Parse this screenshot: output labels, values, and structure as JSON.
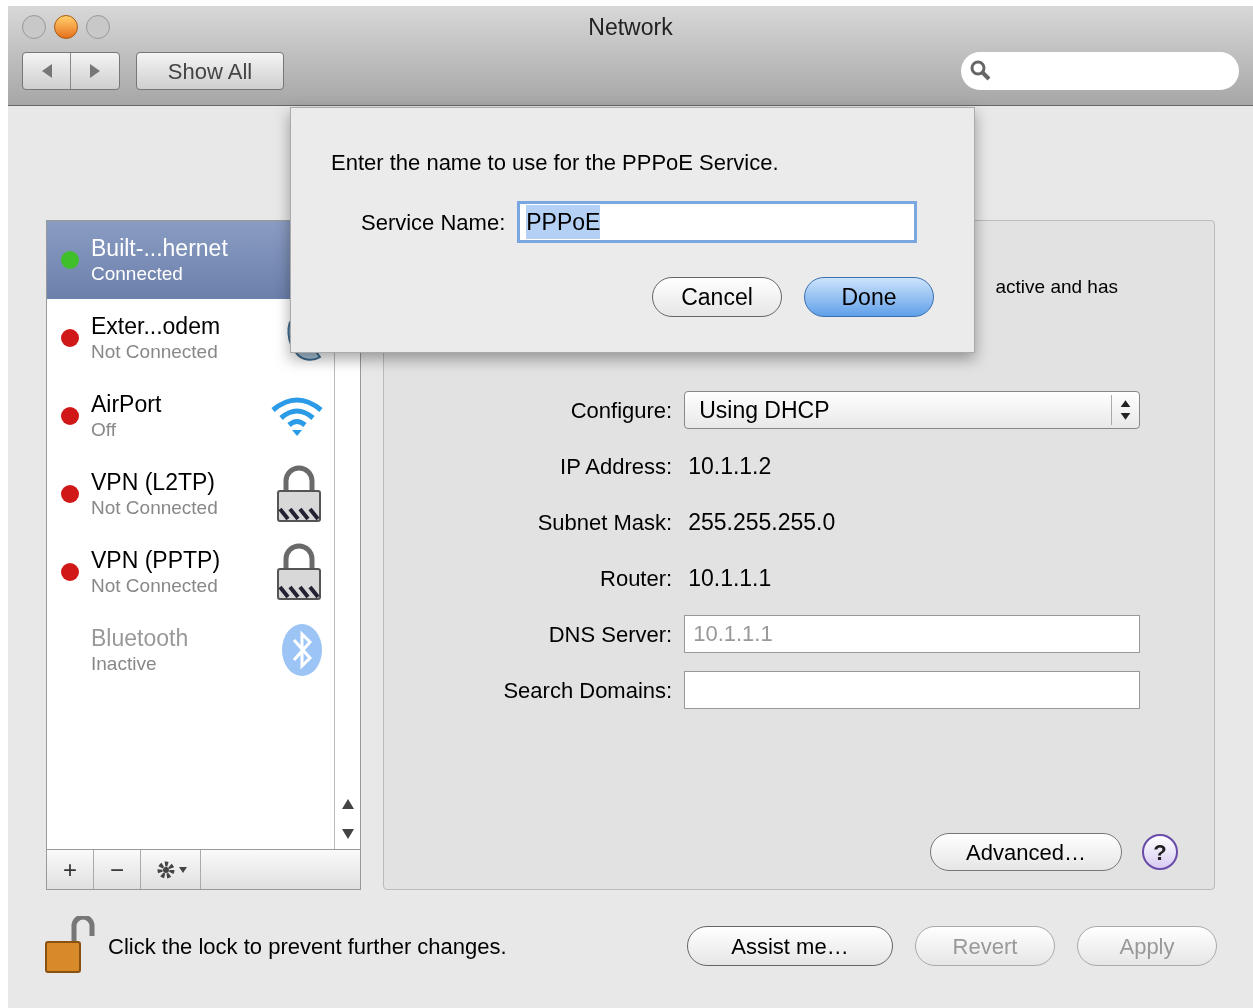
{
  "window": {
    "title": "Network",
    "show_all": "Show All"
  },
  "services": [
    {
      "name": "Built-...hernet",
      "status": "Connected",
      "color": "#3fbf2a",
      "selected": true,
      "inactive": false,
      "kind": "ethernet"
    },
    {
      "name": "Exter...odem",
      "status": "Not Connected",
      "color": "#d01818",
      "selected": false,
      "inactive": false,
      "kind": "phone"
    },
    {
      "name": "AirPort",
      "status": "Off",
      "color": "#d01818",
      "selected": false,
      "inactive": false,
      "kind": "wifi"
    },
    {
      "name": "VPN (L2TP)",
      "status": "Not Connected",
      "color": "#d01818",
      "selected": false,
      "inactive": false,
      "kind": "lock"
    },
    {
      "name": "VPN (PPTP)",
      "status": "Not Connected",
      "color": "#d01818",
      "selected": false,
      "inactive": false,
      "kind": "lock"
    },
    {
      "name": "Bluetooth",
      "status": "Inactive",
      "selected": false,
      "inactive": true,
      "kind": "bluetooth"
    }
  ],
  "sidebar_toolbar": [
    "+",
    "−"
  ],
  "detail": {
    "status_text": "active and has",
    "rows": [
      {
        "kind": "select",
        "label": "Configure:",
        "value": "Using DHCP"
      },
      {
        "kind": "text",
        "label": "IP Address:",
        "value": "10.1.1.2"
      },
      {
        "kind": "text",
        "label": "Subnet Mask:",
        "value": "255.255.255.0"
      },
      {
        "kind": "text",
        "label": "Router:",
        "value": "10.1.1.1"
      },
      {
        "kind": "field",
        "label": "DNS Server:",
        "placeholder": "10.1.1.1"
      },
      {
        "kind": "field",
        "label": "Search Domains:"
      }
    ],
    "advanced": "Advanced…",
    "help": "?"
  },
  "lock_text": "Click the lock to prevent further changes.",
  "buttons": [
    {
      "label": "Assist me…",
      "disabled": false
    },
    {
      "label": "Revert",
      "disabled": true
    },
    {
      "label": "Apply",
      "disabled": true
    }
  ],
  "sheet": {
    "prompt": "Enter the name to use for the PPPoE Service.",
    "label": "Service Name:",
    "value": "PPPoE",
    "buttons": [
      {
        "label": "Cancel",
        "default": false
      },
      {
        "label": "Done",
        "default": true
      }
    ]
  }
}
